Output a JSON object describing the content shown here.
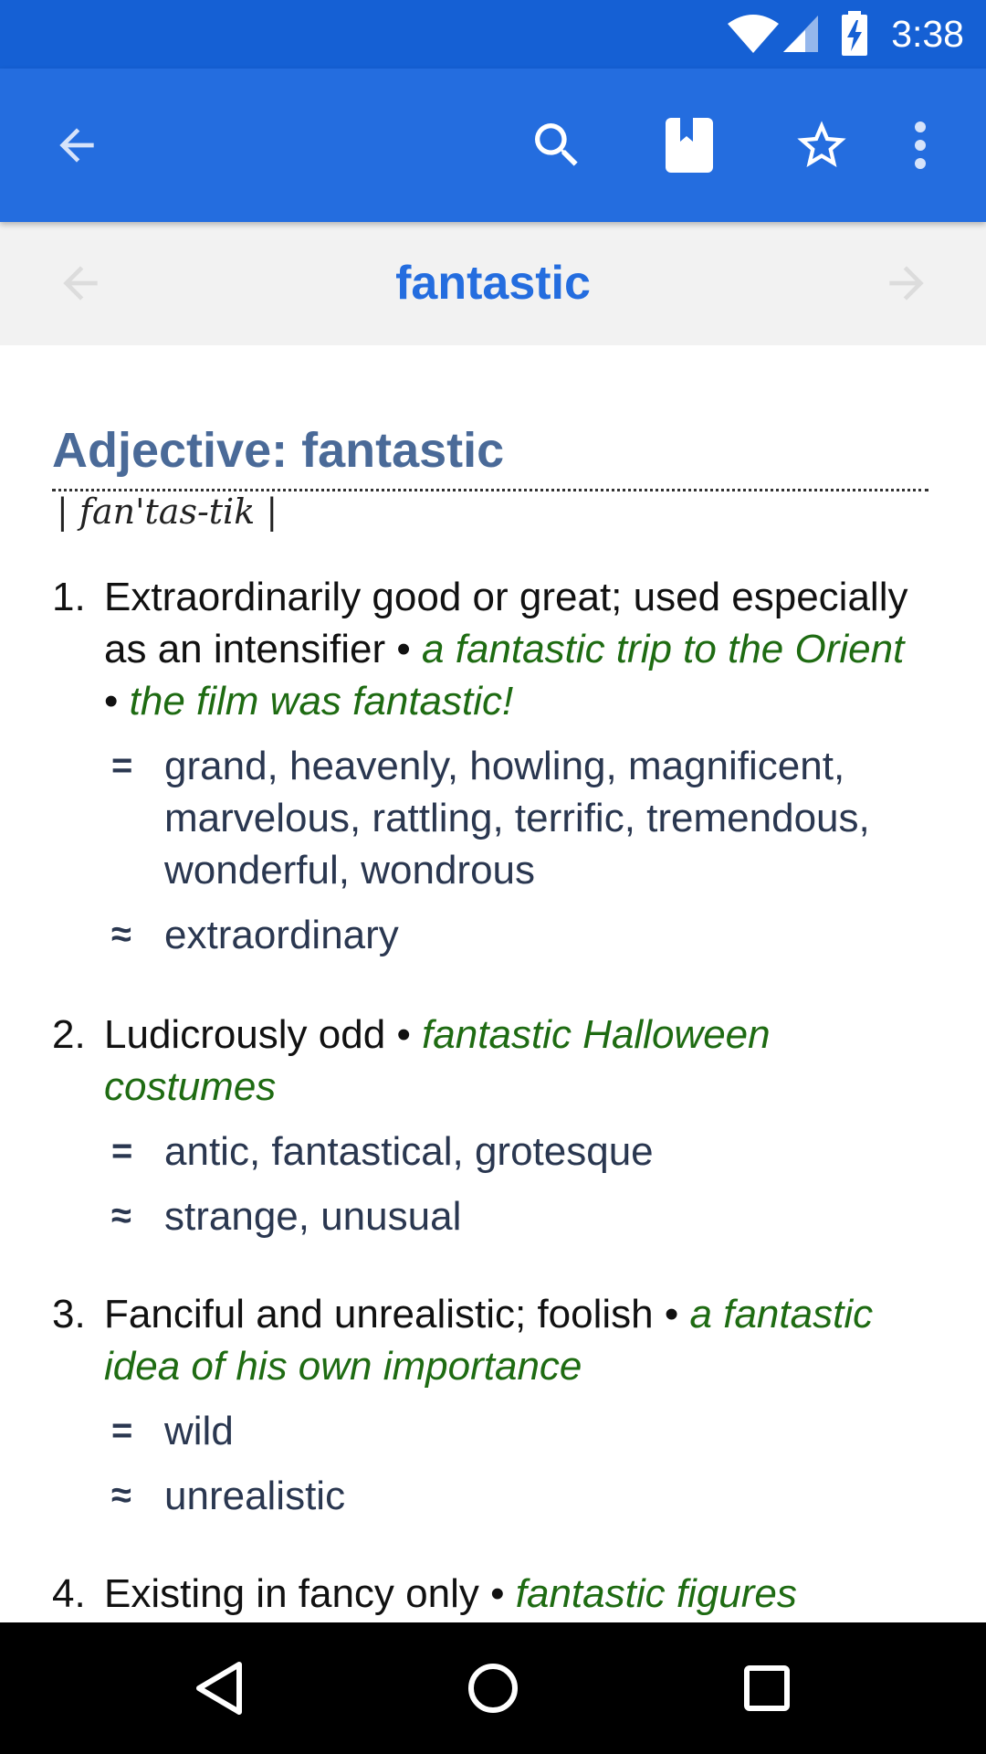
{
  "status_bar": {
    "time": "3:38",
    "icons": [
      "wifi-icon",
      "cell-signal-icon",
      "battery-charging-icon"
    ]
  },
  "app_bar": {
    "icons": [
      "back-arrow-icon",
      "search-icon",
      "bookmark-icon",
      "star-icon",
      "more-vert-icon"
    ],
    "color": "#246ddf"
  },
  "word_nav": {
    "word": "fantastic",
    "icons": [
      "previous-word-arrow-icon",
      "next-word-arrow-icon"
    ]
  },
  "entry": {
    "heading": "Adjective: fantastic",
    "pronunciation": "| fan'tas-tik |",
    "senses": [
      {
        "number": "1.",
        "definition": "Extraordinarily good or great; used especially as an intensifier",
        "examples": [
          "a fantastic trip to the Orient",
          "the film was fantastic!"
        ],
        "synonyms_symbol": "=",
        "synonyms": "grand, heavenly, howling, magnificent, marvelous, rattling, terrific, tremendous, wonderful, wondrous",
        "similar_symbol": "≈",
        "similar": "extraordinary"
      },
      {
        "number": "2.",
        "definition": "Ludicrously odd",
        "examples": [
          "fantastic Halloween costumes"
        ],
        "synonyms_symbol": "=",
        "synonyms": "antic, fantastical, grotesque",
        "similar_symbol": "≈",
        "similar": "strange, unusual"
      },
      {
        "number": "3.",
        "definition": "Fanciful and unrealistic; foolish",
        "examples": [
          "a fantastic idea of his own importance"
        ],
        "synonyms_symbol": "=",
        "synonyms": "wild",
        "similar_symbol": "≈",
        "similar": "unrealistic"
      },
      {
        "number": "4.",
        "definition": "Existing in fancy only",
        "examples": [
          "fantastic figures"
        ]
      }
    ],
    "bullet": "•"
  },
  "nav_bar": {
    "icons": [
      "nav-back-icon",
      "nav-home-icon",
      "nav-recents-icon"
    ]
  },
  "colors": {
    "status_bar": "#1560d4",
    "accent": "#246ddf",
    "heading": "#4a6a98",
    "example": "#1e6b12",
    "related_words": "#2a3750"
  }
}
